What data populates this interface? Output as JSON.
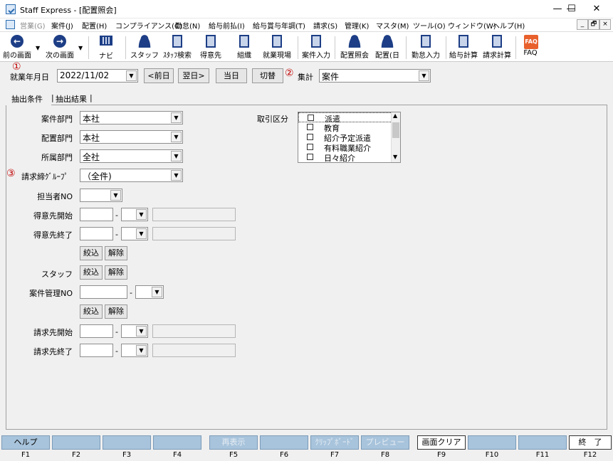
{
  "window": {
    "title": "Staff Express - [配置照会]",
    "min": "—",
    "max": "☐",
    "close": "✕"
  },
  "menu": [
    {
      "label": "営業(G)",
      "disabled": true
    },
    {
      "label": "案件(J)"
    },
    {
      "label": "配置(H)"
    },
    {
      "label": "コンプライアンス(C)"
    },
    {
      "label": "勤怠(N)"
    },
    {
      "label": "給与前払(I)"
    },
    {
      "label": "給与賞与年調(T)"
    },
    {
      "label": "請求(S)"
    },
    {
      "label": "管理(K)"
    },
    {
      "label": "マスタ(M)"
    },
    {
      "label": "ツール(O)"
    },
    {
      "label": "ウィンドウ(W)"
    },
    {
      "label": "ヘルプ(H)"
    }
  ],
  "mdi_controls": [
    "_",
    "🗗",
    "×"
  ],
  "toolbar": {
    "prev": "前の画面",
    "next": "次の画面",
    "navi": "ナビ",
    "staff": "スタッフ",
    "staff_search": "ｽﾀｯﾌ検索",
    "client": "得意先",
    "org": "組織",
    "site": "就業現場",
    "case_input": "案件入力",
    "assign_query": "配置照会",
    "assign_day": "配置(日",
    "attendance_input": "勤怠入力",
    "pay_calc": "給与計算",
    "bill_calc": "請求計算",
    "faq": "FAQ"
  },
  "top": {
    "mark1": "①",
    "work_date_label": "就業年月日",
    "work_date_value": "2022/11/02",
    "prev_day": "<前日",
    "next_day": "翌日>",
    "today": "当日",
    "switch": "切替",
    "mark2": "②",
    "agg_label": "集計",
    "agg_value": "案件"
  },
  "tabs": [
    "抽出条件",
    "抽出結果"
  ],
  "form": {
    "case_dept_label": "案件部門",
    "case_dept_value": "本社",
    "assign_dept_label": "配置部門",
    "assign_dept_value": "本社",
    "belong_dept_label": "所属部門",
    "belong_dept_value": "全社",
    "mark3": "③",
    "bill_group_label": "請求締ｸﾞﾙｰﾌﾟ",
    "bill_group_value": "（全件)",
    "staff_no_label": "担当者NO",
    "client_start_label": "得意先開始",
    "client_end_label": "得意先終了",
    "narrow": "絞込",
    "clear": "解除",
    "staff_label": "スタッフ",
    "case_mgmt_label": "案件管理NO",
    "bill_start_label": "請求先開始",
    "bill_end_label": "請求先終了",
    "dash": "-",
    "trade_label": "取引区分",
    "trade_items": [
      "派遣",
      "教育",
      "紹介予定派遣",
      "有料職業紹介",
      "日々紹介"
    ]
  },
  "fkeys": [
    {
      "label": "ヘルプ",
      "key": "F1"
    },
    {
      "label": "",
      "key": "F2"
    },
    {
      "label": "",
      "key": "F3"
    },
    {
      "label": "",
      "key": "F4"
    },
    {
      "label": "再表示",
      "key": "F5",
      "disabled": true
    },
    {
      "label": "",
      "key": "F6"
    },
    {
      "label": "ｸﾘｯﾌﾟﾎﾞｰﾄﾞ",
      "key": "F7",
      "disabled": true
    },
    {
      "label": "プレビュー",
      "key": "F8",
      "disabled": true
    },
    {
      "label": "画面クリア",
      "key": "F9",
      "active": true
    },
    {
      "label": "",
      "key": "F10"
    },
    {
      "label": "",
      "key": "F11"
    },
    {
      "label": "終　了",
      "key": "F12",
      "active": true
    }
  ]
}
